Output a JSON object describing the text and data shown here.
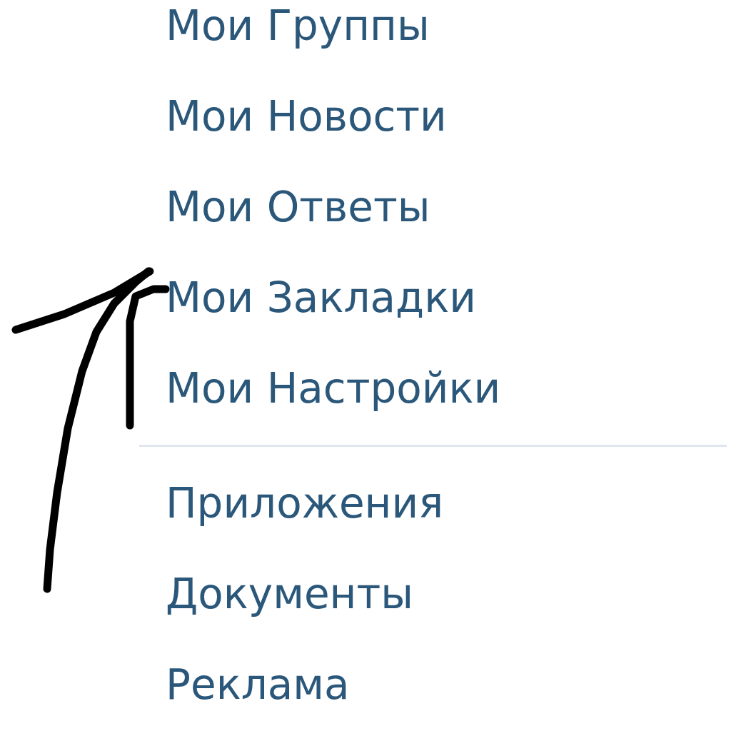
{
  "menu": {
    "sections": [
      {
        "items": [
          "Мои Группы",
          "Мои Новости",
          "Мои Ответы",
          "Мои Закладки",
          "Мои Настройки"
        ]
      },
      {
        "items": [
          "Приложения",
          "Документы",
          "Реклама"
        ]
      }
    ]
  }
}
